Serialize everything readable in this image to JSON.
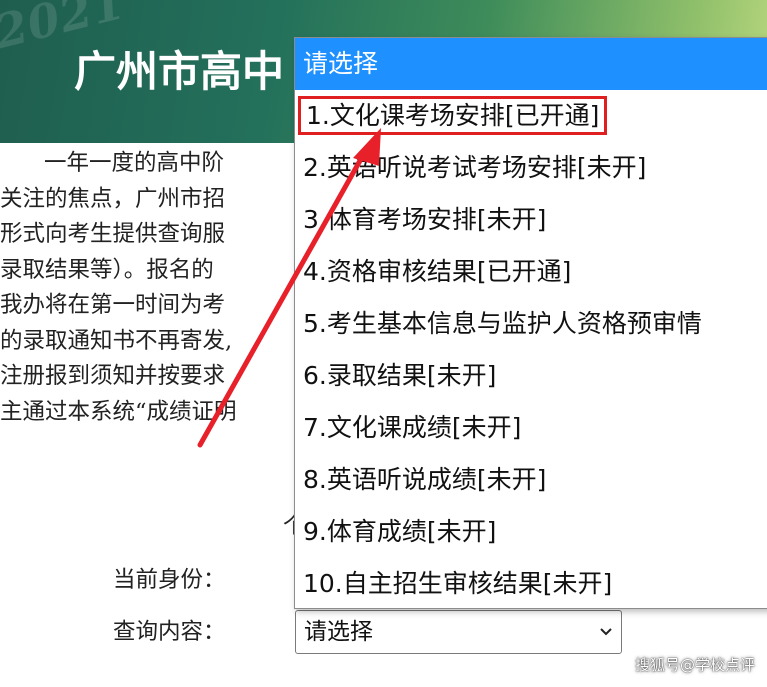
{
  "banner": {
    "watermark": "2021",
    "title": "广州市高中"
  },
  "body_text": {
    "lines": [
      "一年一度的高中阶",
      "关注的焦点，广州市招",
      "形式向考生提供查询服",
      "录取结果等）。报名的",
      "我办将在第一时间为考",
      "的录取通知书不再寄发,",
      "注册报到须知并按要求",
      "主通过本系统“成绩证明"
    ],
    "partial_char": "个"
  },
  "form": {
    "identity_label": "当前身份：",
    "query_label": "查询内容：",
    "select_value": "请选择",
    "chevron": "chevron-down-icon"
  },
  "dropdown": {
    "header": "请选择",
    "options": [
      "1.文化课考场安排[已开通]",
      "2.英语听说考试考场安排[未开]",
      "3.体育考场安排[未开]",
      "4.资格审核结果[已开通]",
      "5.考生基本信息与监护人资格预审情",
      "6.录取结果[未开]",
      "7.文化课成绩[未开]",
      "8.英语听说成绩[未开]",
      "9.体育成绩[未开]",
      "10.自主招生审核结果[未开]"
    ],
    "highlighted_index": 0,
    "header_color": "#1e90ff",
    "highlight_color": "#e02020"
  },
  "annotation": {
    "arrow_color": "#e8202a",
    "arrow_icon": "red-arrow-icon"
  },
  "credit": "搜狐号@学校点评"
}
